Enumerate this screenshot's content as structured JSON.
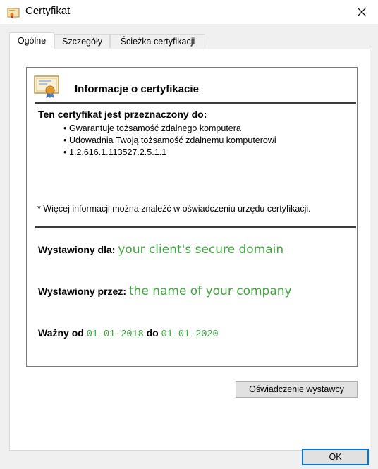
{
  "window": {
    "title": "Certyfikat",
    "close_icon": "close-icon"
  },
  "tabs": [
    {
      "label": "Ogólne",
      "active": true
    },
    {
      "label": "Szczegóły",
      "active": false
    },
    {
      "label": "Ścieżka certyfikacji",
      "active": false
    }
  ],
  "info": {
    "heading": "Informacje o certyfikacie",
    "purpose_title": "Ten certyfikat jest przeznaczony do:",
    "purposes": [
      "Gwarantuje tożsamość zdalnego komputera",
      "Udowadnia Twoją tożsamość zdalnemu komputerowi",
      "1.2.616.1.113527.2.5.1.1"
    ],
    "footnote": "* Więcej informacji można znaleźć w oświadczeniu urzędu certyfikacji.",
    "issued_to_label": "Wystawiony dla:",
    "issued_to_value": "your client's secure domain",
    "issued_by_label": "Wystawiony przez:",
    "issued_by_value": "the name of your company",
    "valid_from_label": "Ważny od",
    "valid_from_value": "01-01-2018",
    "valid_to_label": "do",
    "valid_to_value": "01-01-2020"
  },
  "buttons": {
    "issuer_statement": "Oświadczenie wystawcy",
    "ok": "OK"
  },
  "colors": {
    "value_green": "#3fa33f",
    "accent": "#0078d7"
  }
}
